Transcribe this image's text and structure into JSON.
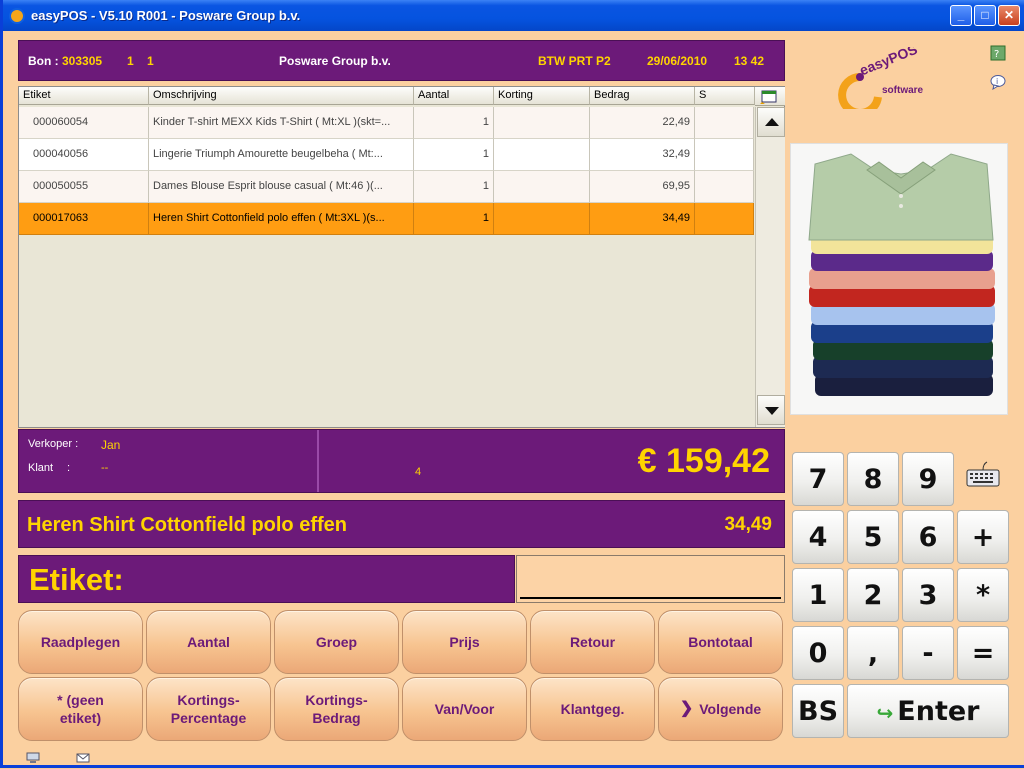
{
  "window": {
    "title": "easyPOS - V5.10 R001 - Posware Group b.v."
  },
  "header": {
    "bon_label": "Bon :",
    "bon_number": "303305",
    "field1": "1",
    "field2": "1",
    "company": "Posware Group b.v.",
    "btw": "BTW PRT P2",
    "date": "29/06/2010",
    "time": "13 42"
  },
  "grid": {
    "columns": [
      "Etiket",
      "Omschrijving",
      "Aantal",
      "Korting",
      "Bedrag",
      "S"
    ],
    "rows": [
      {
        "etiket": "000060054",
        "omschrijving": "Kinder T-shirt MEXX Kids T-Shirt  ( Mt:XL )(skt=...",
        "aantal": "1",
        "korting": "",
        "bedrag": "22,49",
        "s": ""
      },
      {
        "etiket": "000040056",
        "omschrijving": "Lingerie Triumph Amourette beugelbeha  ( Mt:...",
        "aantal": "1",
        "korting": "",
        "bedrag": "32,49",
        "s": ""
      },
      {
        "etiket": "000050055",
        "omschrijving": "Dames Blouse Esprit blouse casual  ( Mt:46 )(...",
        "aantal": "1",
        "korting": "",
        "bedrag": "69,95",
        "s": ""
      },
      {
        "etiket": "000017063",
        "omschrijving": "Heren Shirt Cottonfield polo effen  ( Mt:3XL )(s...",
        "aantal": "1",
        "korting": "",
        "bedrag": "34,49",
        "s": ""
      }
    ]
  },
  "totals": {
    "verkoper_label": "Verkoper :",
    "verkoper": "Jan",
    "klant_label": "Klant",
    "klant_sep": ":",
    "klant": "--",
    "count": "4",
    "amount": "€ 159,42"
  },
  "current_item": {
    "name": "Heren Shirt Cottonfield polo effen",
    "price": "34,49"
  },
  "etiket": {
    "label": "Etiket:",
    "value": ""
  },
  "buttons": {
    "raadplegen": "Raadplegen",
    "aantal": "Aantal",
    "groep": "Groep",
    "prijs": "Prijs",
    "retour": "Retour",
    "bontotaal": "Bontotaal",
    "geen_etiket_1": "* (geen",
    "geen_etiket_2": "etiket)",
    "korting_pct_1": "Kortings-",
    "korting_pct_2": "Percentage",
    "korting_bedrag_1": "Kortings-",
    "korting_bedrag_2": "Bedrag",
    "van_voor": "Van/Voor",
    "klantgeg": "Klantgeg.",
    "volgende": "Volgende"
  },
  "keypad": {
    "k7": "7",
    "k8": "8",
    "k9": "9",
    "k4": "4",
    "k5": "5",
    "k6": "6",
    "plus": "+",
    "k1": "1",
    "k2": "2",
    "k3": "3",
    "times": "*",
    "k0": "0",
    "comma": ",",
    "minus": "-",
    "equals": "=",
    "bs": "BS",
    "enter": "Enter"
  },
  "logo": {
    "text_top": "easyPOS",
    "text_bottom": "software"
  },
  "colors": {
    "purple": "#6c1a79",
    "yellow": "#ffd400",
    "orange_selection": "#ff9d12",
    "background": "#fbd0a0"
  }
}
